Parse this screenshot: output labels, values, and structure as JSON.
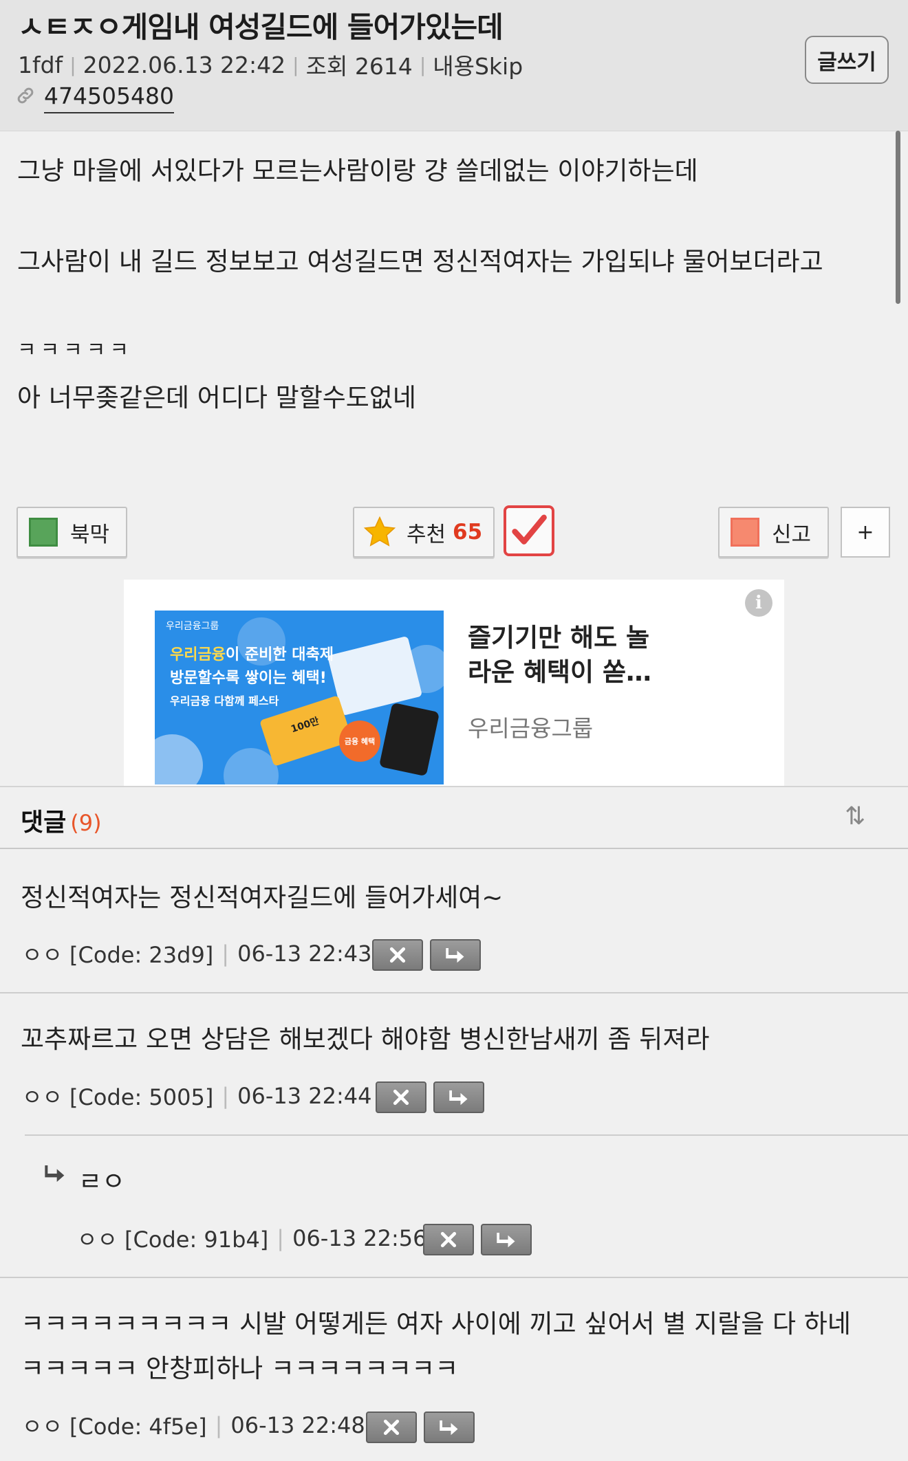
{
  "post": {
    "title": "ㅅㅌㅈㅇ게임내 여성길드에 들어가있는데",
    "author": "1fdf",
    "date": "2022.06.13 22:42",
    "views": "조회 2614",
    "skip": "내용Skip",
    "post_id": "474505480",
    "write_label": "글쓰기",
    "body": [
      "그냥 마을에 서있다가 모르는사람이랑 걍 쓸데없는 이야기하는데",
      "그사람이 내 길드 정보보고 여성길드면 정신적여자는 가입되냐 물어보더라고",
      "ㅋㅋㅋㅋㅋ",
      "아 너무좆같은데 어디다 말할수도없네"
    ]
  },
  "actions": {
    "bookmark_label": "북막",
    "recommend_label": "추천",
    "recommend_count": "65",
    "report_label": "신고",
    "plus_label": "+"
  },
  "ad": {
    "banner_brand": "우리금융그룹",
    "banner_line1a": "우리금융",
    "banner_line1b": "이 준비한 대축제",
    "banner_line2": "방문할수록 쌓이는 혜택!",
    "banner_line3": "우리금융 다함께 페스타",
    "banner_ticket": "100만",
    "banner_badge": "금융 혜택",
    "title_line1": "즐기기만 해도 놀",
    "title_line2": "라운 혜택이 쏟…",
    "source": "우리금융그룹"
  },
  "comments_header": {
    "label": "댓글",
    "count": "(9)"
  },
  "comments": [
    {
      "text": "정신적여자는 정신적여자길드에 들어가세여~",
      "author": "ㅇㅇ [Code: 23d9]",
      "time": "06-13 22:43"
    },
    {
      "text": "꼬추짜르고 오면 상담은 해보겠다 해야함 병신한남새끼 좀 뒤져라",
      "author": "ㅇㅇ [Code: 5005]",
      "time": "06-13 22:44"
    },
    {
      "text": "ㄹㅇ",
      "author": "ㅇㅇ [Code: 91b4]",
      "time": "06-13 22:56"
    },
    {
      "text_line1": "ㅋㅋㅋㅋㅋㅋㅋㅋㅋ 시발 어떻게든 여자 사이에 끼고 싶어서 별 지랄을 다 하네",
      "text_line2": "ㅋㅋㅋㅋㅋ 안창피하나 ㅋㅋㅋㅋㅋㅋㅋㅋ",
      "author": "ㅇㅇ [Code: 4f5e]",
      "time": "06-13 22:48"
    }
  ],
  "icons": {
    "link": "link-icon",
    "star": "star-icon",
    "check": "check-icon",
    "info": "info-icon",
    "sort": "sort-icon",
    "delete": "close-icon",
    "reply": "reply-arrow-icon"
  },
  "colors": {
    "accent_red": "#e03a1f",
    "comment_count": "#e8562a",
    "bookmark_green": "#58a45a",
    "report_salmon": "#f6896f"
  }
}
